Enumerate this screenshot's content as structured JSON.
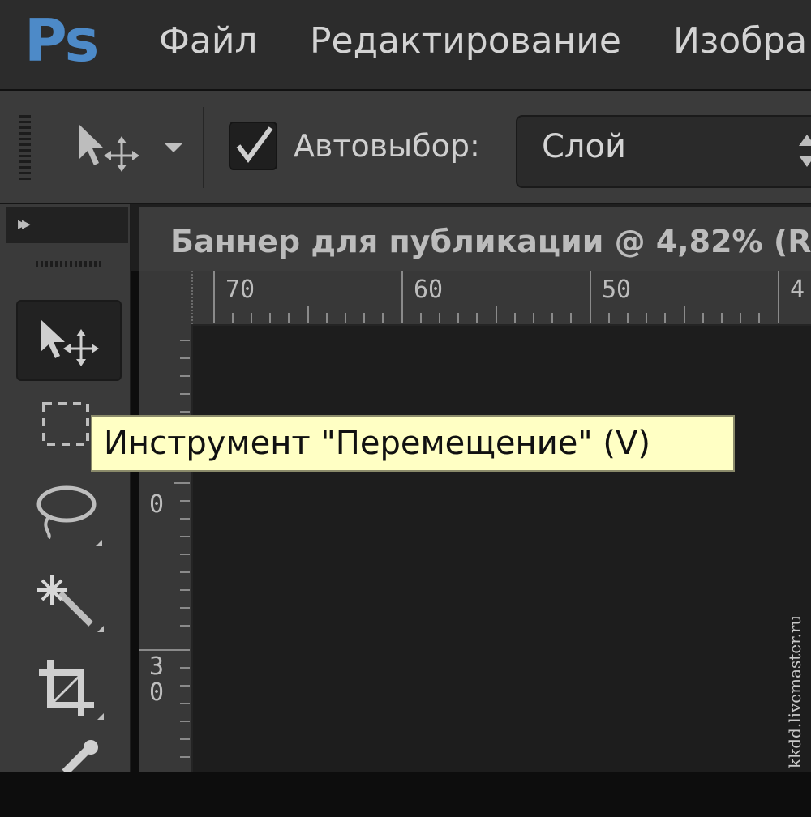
{
  "app": {
    "logo": "Ps"
  },
  "menubar": {
    "items": [
      "Файл",
      "Редактирование",
      "Изобра"
    ]
  },
  "options_bar": {
    "tool_preset_icon": "move-tool-icon",
    "autoselect_label": "Автовыбор:",
    "autoselect_checked": true,
    "autoselect_target": "Слой"
  },
  "toolbox": {
    "collapse_label": "▸▸",
    "tools": [
      {
        "icon": "move-tool-icon",
        "active": true
      },
      {
        "icon": "rectangular-marquee-icon",
        "active": false
      },
      {
        "icon": "lasso-icon",
        "active": false
      },
      {
        "icon": "magic-wand-icon",
        "active": false
      },
      {
        "icon": "crop-icon",
        "active": false
      },
      {
        "icon": "eyedropper-icon",
        "active": false
      }
    ]
  },
  "document": {
    "tab_title": "Баннер для публикации @ 4,82% (R"
  },
  "rulers": {
    "top_labels": [
      "70",
      "60",
      "50",
      "4"
    ],
    "left_labels": [
      "0",
      "3",
      "0"
    ]
  },
  "tooltip": {
    "text": "Инструмент \"Перемещение\" (V)"
  },
  "watermark": {
    "text": "kkdd.livemaster.ru"
  }
}
